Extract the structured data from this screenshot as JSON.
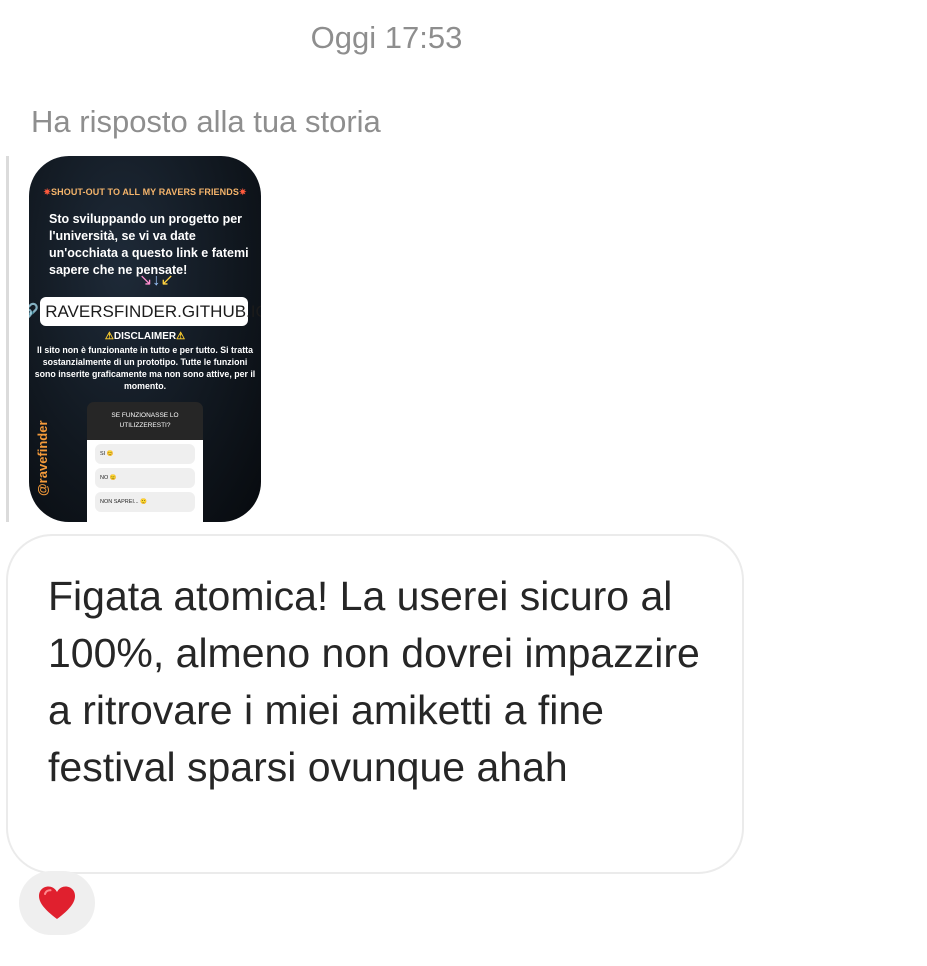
{
  "header": {
    "timestamp": "Oggi 17:53"
  },
  "reply_note": "Ha risposto alla tua storia",
  "story": {
    "shout_out": "SHOUT-OUT TO ALL MY RAVERS FRIENDS",
    "body": "Sto sviluppando un progetto per l'università, se vi va date un'occhiata a questo link e fatemi sapere che ne pensate!",
    "link": "RAVERSFINDER.GITHUB.IO",
    "disclaimer_title": "DISCLAIMER",
    "disclaimer_text": "Il sito non è funzionante in tutto e per tutto. Si tratta sostanzialmente di un prototipo. Tutte le funzioni sono inserite graficamente ma non sono attive, per il momento.",
    "handle": "@ravefinder",
    "poll": {
      "question": "SE FUNZIONASSE LO UTILIZZERESTI?",
      "options": [
        "SI 😊",
        "NO 😐",
        "NON SAPREI... 🙂"
      ]
    }
  },
  "message": {
    "text": "Figata atomica! La userei sicuro al 100%, almeno non dovrei impazzire a ritrovare i miei amiketti a fine festival sparsi ovunque ahah"
  },
  "reaction": {
    "icon": "heart-icon",
    "color": "#e0202e"
  }
}
